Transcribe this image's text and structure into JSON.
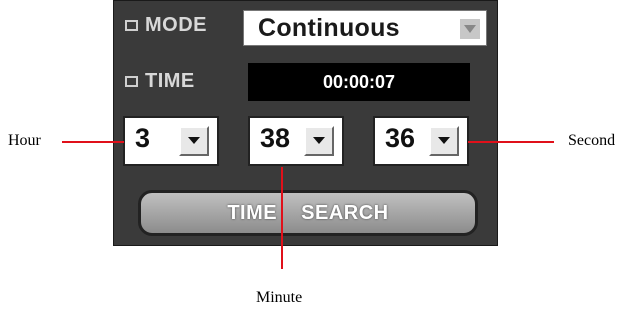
{
  "mode": {
    "label": "MODE",
    "value": "Continuous"
  },
  "time": {
    "label": "TIME",
    "display": "00:00:07"
  },
  "spinners": {
    "hour": "3",
    "minute": "38",
    "second": "36"
  },
  "search_button": {
    "label": "TIME SEARCH"
  },
  "callouts": {
    "hour": "Hour",
    "minute": "Minute",
    "second": "Second"
  },
  "colors": {
    "callout_line": "#e0101a",
    "panel": "#3a3a3a"
  }
}
